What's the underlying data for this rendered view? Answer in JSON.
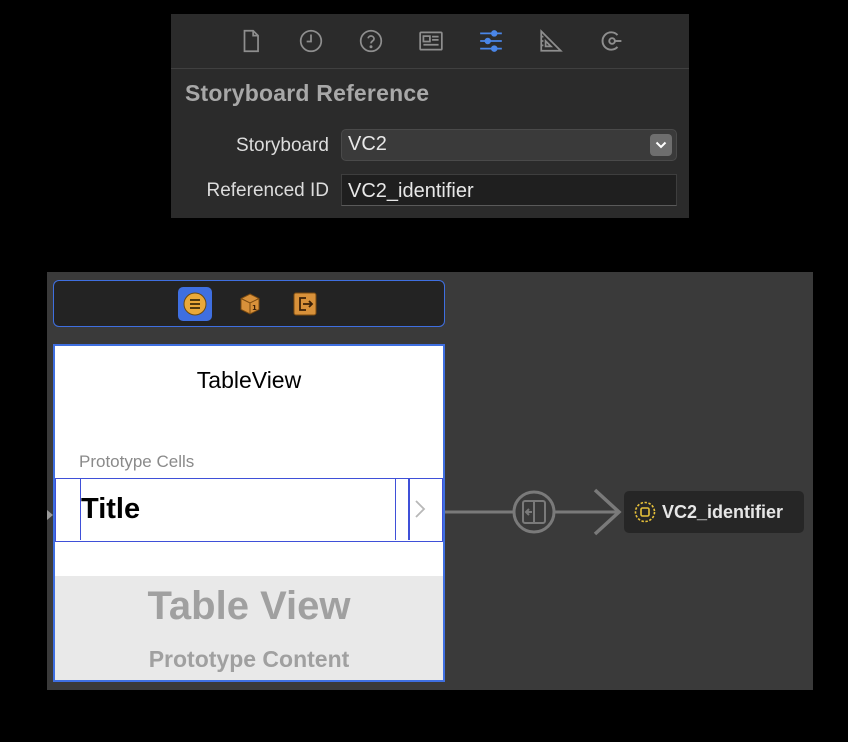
{
  "inspector": {
    "tabs": [
      {
        "name": "file-inspector",
        "icon": "document-icon",
        "active": false
      },
      {
        "name": "history-inspector",
        "icon": "clock-icon",
        "active": false
      },
      {
        "name": "quick-help-inspector",
        "icon": "question-icon",
        "active": false
      },
      {
        "name": "identity-inspector",
        "icon": "id-card-icon",
        "active": false
      },
      {
        "name": "attributes-inspector",
        "icon": "sliders-icon",
        "active": true
      },
      {
        "name": "size-inspector",
        "icon": "ruler-icon",
        "active": false
      },
      {
        "name": "connections-inspector",
        "icon": "connections-icon",
        "active": false
      }
    ],
    "title": "Storyboard Reference",
    "storyboard_label": "Storyboard",
    "storyboard_value": "VC2",
    "referenced_id_label": "Referenced ID",
    "referenced_id_value": "VC2_identifier"
  },
  "canvas": {
    "scene_title": "TableView",
    "section_header": "Prototype Cells",
    "cell_title": "Title",
    "placeholder_title": "Table View",
    "placeholder_subtitle": "Prototype Content",
    "reference_label": "VC2_identifier"
  },
  "colors": {
    "accent": "#3f6fe0",
    "active_tab": "#4a86e8",
    "tab_icon": "#8e8e8e"
  }
}
